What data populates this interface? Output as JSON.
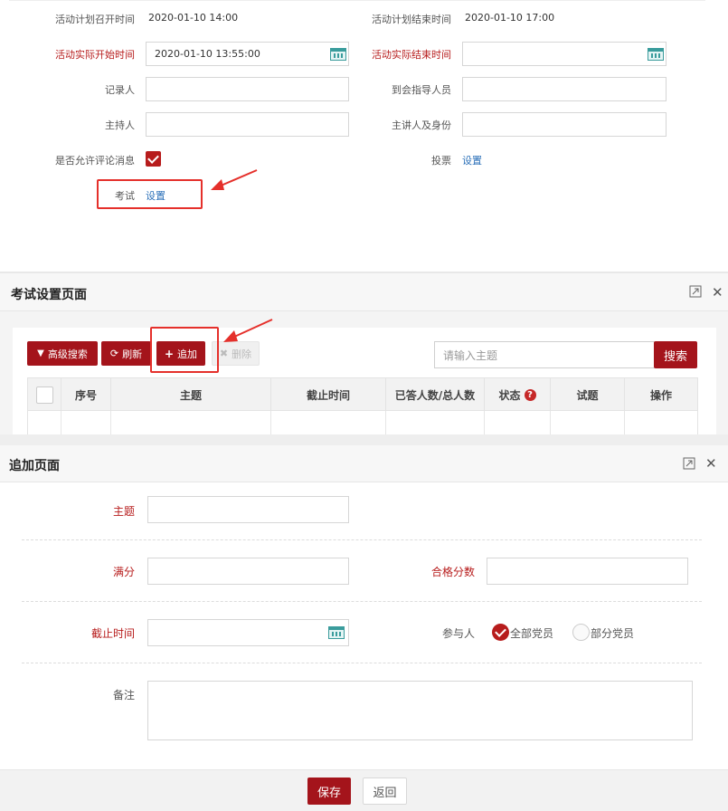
{
  "form_top": {
    "plan_start_label": "活动计划召开时间",
    "plan_start_value": "2020-01-10 14:00",
    "plan_end_label": "活动计划结束时间",
    "plan_end_value": "2020-01-10 17:00",
    "actual_start_label": "活动实际开始时间",
    "actual_start_value": "2020-01-10 13:55:00",
    "actual_end_label": "活动实际结束时间",
    "actual_end_value": "",
    "recorder_label": "记录人",
    "guide_label": "到会指导人员",
    "host_label": "主持人",
    "speaker_label": "主讲人及身份",
    "allow_comment_label": "是否允许评论消息",
    "allow_comment_checked": true,
    "vote_label": "投票",
    "vote_link": "设置",
    "exam_label": "考试",
    "exam_link": "设置"
  },
  "exam_panel": {
    "title": "考试设置页面",
    "toolbar": {
      "advanced_search": "高级搜索",
      "refresh": "刷新",
      "add": "追加",
      "delete": "删除"
    },
    "search_placeholder": "请输入主题",
    "search_button": "搜索",
    "columns": [
      "序号",
      "主题",
      "截止时间",
      "已答人数/总人数",
      "状态",
      "试题",
      "操作"
    ]
  },
  "add_panel": {
    "title": "追加页面",
    "subject_label": "主题",
    "full_score_label": "满分",
    "pass_score_label": "合格分数",
    "deadline_label": "截止时间",
    "participants_label": "参与人",
    "option_all": "全部党员",
    "option_part": "部分党员",
    "selected_option": "全部党员",
    "remark_label": "备注",
    "save_button": "保存",
    "back_button": "返回"
  },
  "colors": {
    "brand_red": "#a4141b",
    "required_label": "#b71c1c",
    "link_blue": "#2a6fb8",
    "highlight_box": "#e5302b"
  }
}
